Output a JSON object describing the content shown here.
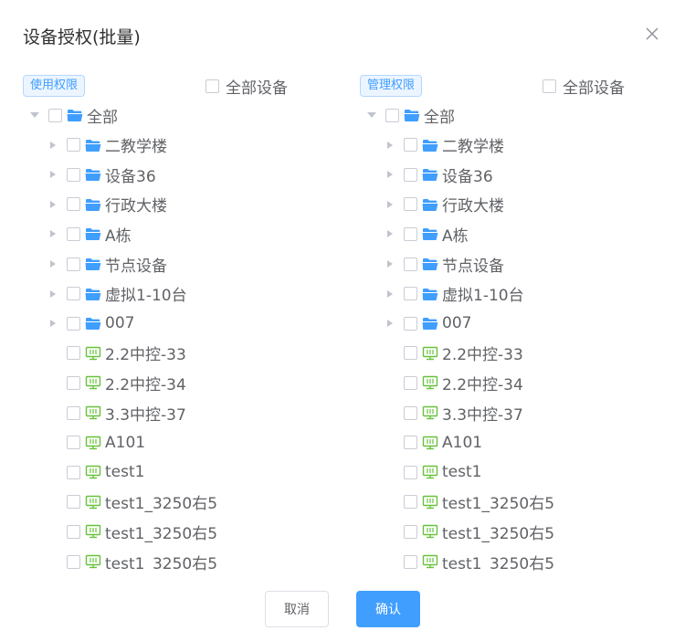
{
  "dialog": {
    "title": "设备授权(批量)",
    "cancel_label": "取消",
    "confirm_label": "确认"
  },
  "colors": {
    "primary": "#409eff",
    "folder": "#409eff",
    "device": "#67c23a"
  },
  "panels": [
    {
      "tag": "使用权限",
      "select_all_label": "全部设备",
      "root": {
        "label": "全部",
        "expanded": true
      },
      "folders": [
        "二教学楼",
        "设备36",
        "行政大楼",
        "A栋",
        "节点设备",
        "虚拟1-10台",
        "007"
      ],
      "devices": [
        "2.2中控-33",
        "2.2中控-34",
        "3.3中控-37",
        "A101",
        "test1",
        "test1_3250右5",
        "test1_3250右5",
        "test1_3250右5"
      ]
    },
    {
      "tag": "管理权限",
      "select_all_label": "全部设备",
      "root": {
        "label": "全部",
        "expanded": true
      },
      "folders": [
        "二教学楼",
        "设备36",
        "行政大楼",
        "A栋",
        "节点设备",
        "虚拟1-10台",
        "007"
      ],
      "devices": [
        "2.2中控-33",
        "2.2中控-34",
        "3.3中控-37",
        "A101",
        "test1",
        "test1_3250右5",
        "test1_3250右5",
        "test1_3250右5"
      ]
    }
  ]
}
